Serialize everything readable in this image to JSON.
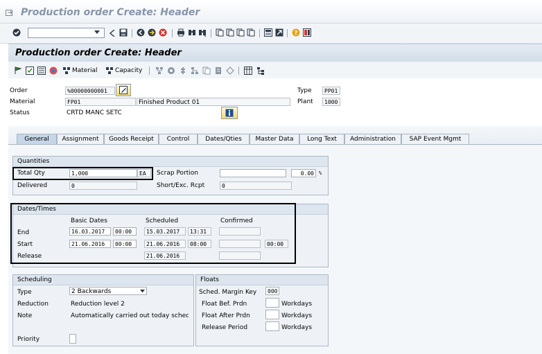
{
  "window": {
    "title": "Production order Create: Header"
  },
  "toolbar": {
    "command_field": {
      "value": "",
      "placeholder": ""
    }
  },
  "header": {
    "title": "Production order Create: Header"
  },
  "app_toolbar": {
    "material_label": "Material",
    "capacity_label": "Capacity"
  },
  "order": {
    "order_label": "Order",
    "order_value": "%00000000001",
    "material_label": "Material",
    "material_value": "FP01",
    "material_desc": "Finished Product 01",
    "status_label": "Status",
    "status_value": "CRTD MANC SETC",
    "type_label": "Type",
    "type_value": "PP01",
    "plant_label": "Plant",
    "plant_value": "1000"
  },
  "tabs": [
    {
      "label": "General",
      "active": true
    },
    {
      "label": "Assignment"
    },
    {
      "label": "Goods Receipt"
    },
    {
      "label": "Control"
    },
    {
      "label": "Dates/Qties"
    },
    {
      "label": "Master Data"
    },
    {
      "label": "Long Text"
    },
    {
      "label": "Administration"
    },
    {
      "label": "SAP Event Mgmt"
    }
  ],
  "quantities": {
    "title": "Quantities",
    "total_qty_label": "Total Qty",
    "total_qty_value": "1,000",
    "unit": "EA",
    "scrap_label": "Scrap Portion",
    "scrap_value": "",
    "scrap_pct": "0.00",
    "pct_sign": "%",
    "delivered_label": "Delivered",
    "delivered_value": "0",
    "short_label": "Short/Exc. Rcpt",
    "short_value": "0"
  },
  "dates": {
    "title": "Dates/Times",
    "col_basic": "Basic Dates",
    "col_scheduled": "Scheduled",
    "col_confirmed": "Confirmed",
    "end_label": "End",
    "end_basic_date": "16.03.2017",
    "end_basic_time": "00:00",
    "end_sched_date": "15.03.2017",
    "end_sched_time": "13:31",
    "start_label": "Start",
    "start_basic_date": "21.06.2016",
    "start_basic_time": "00:00",
    "start_sched_date": "21.06.2016",
    "start_sched_time": "08:00",
    "start_conf_time": "00:00",
    "release_label": "Release",
    "release_sched_date": "21.06.2016"
  },
  "scheduling": {
    "title": "Scheduling",
    "type_label": "Type",
    "type_value": "2 Backwards",
    "reduction_label": "Reduction",
    "reduction_value": "Reduction level 2",
    "note_label": "Note",
    "note_value": "Automatically carried out today sched…",
    "priority_label": "Priority",
    "priority_value": ""
  },
  "floats": {
    "title": "Floats",
    "margin_label": "Sched. Margin Key",
    "margin_value": "000",
    "before_label": "Float Bef. Prdn",
    "before_value": "",
    "before_unit": "Workdays",
    "after_label": "Float After Prdn",
    "after_value": "",
    "after_unit": "Workdays",
    "release_label": "Release Period",
    "release_value": "",
    "release_unit": "Workdays"
  },
  "colors": {
    "accent": "#2b4e7e",
    "panel": "#eef2f6",
    "header_bar": "#dde5ee"
  }
}
